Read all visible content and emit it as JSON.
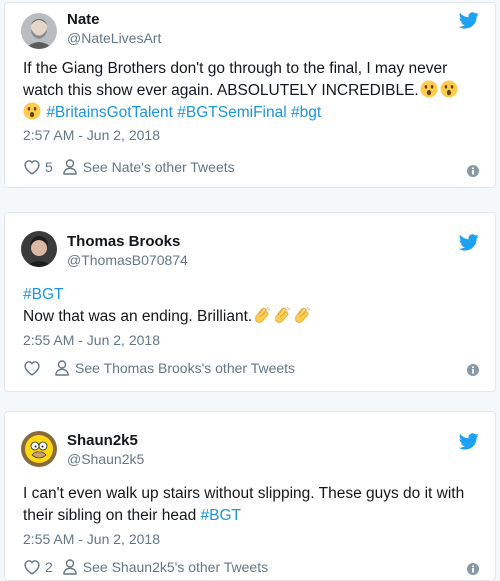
{
  "colors": {
    "twitter_blue": "#1da1f2",
    "hashtag": "#1b95e0",
    "secondary_text": "#657786",
    "primary_text": "#14171a"
  },
  "tweets": [
    {
      "name": "Nate",
      "handle": "@NateLivesArt",
      "avatar_icon": "bearded-man-avatar",
      "body_line1": "If the Giang Brothers don't go through to the final, I may never",
      "body_line2": "watch this show ever again. ABSOLUTELY INCREDIBLE.",
      "body_emoji": [
        "astonished-face-emoji",
        "astonished-face-emoji",
        "astonished-face-emoji"
      ],
      "hashtags": [
        "#BritainsGotTalent",
        "#BGTSemiFinal",
        "#bgt"
      ],
      "timestamp": "2:57 AM - Jun 2, 2018",
      "like_count": "5",
      "other_tweets": "See Nate's other Tweets"
    },
    {
      "name": "Thomas Brooks",
      "handle": "@ThomasB070874",
      "avatar_icon": "dark-haired-man-avatar",
      "hashtag_line": "#BGT",
      "body_line": "Now that was an ending. Brilliant.",
      "body_emoji": [
        "clapping-hands-emoji",
        "clapping-hands-emoji",
        "clapping-hands-emoji"
      ],
      "timestamp": "2:55 AM - Jun 2, 2018",
      "like_count": "",
      "other_tweets": "See Thomas Brooks's other Tweets"
    },
    {
      "name": "Shaun2k5",
      "handle": "@Shaun2k5",
      "avatar_icon": "homer-cartoon-avatar",
      "body_line1": "I can't even walk up stairs without slipping. These guys do it with",
      "body_line2": "their sibling on their head",
      "hashtag": "#BGT",
      "timestamp": "2:55 AM - Jun 2, 2018",
      "like_count": "2",
      "other_tweets": "See Shaun2k5's other Tweets"
    }
  ]
}
